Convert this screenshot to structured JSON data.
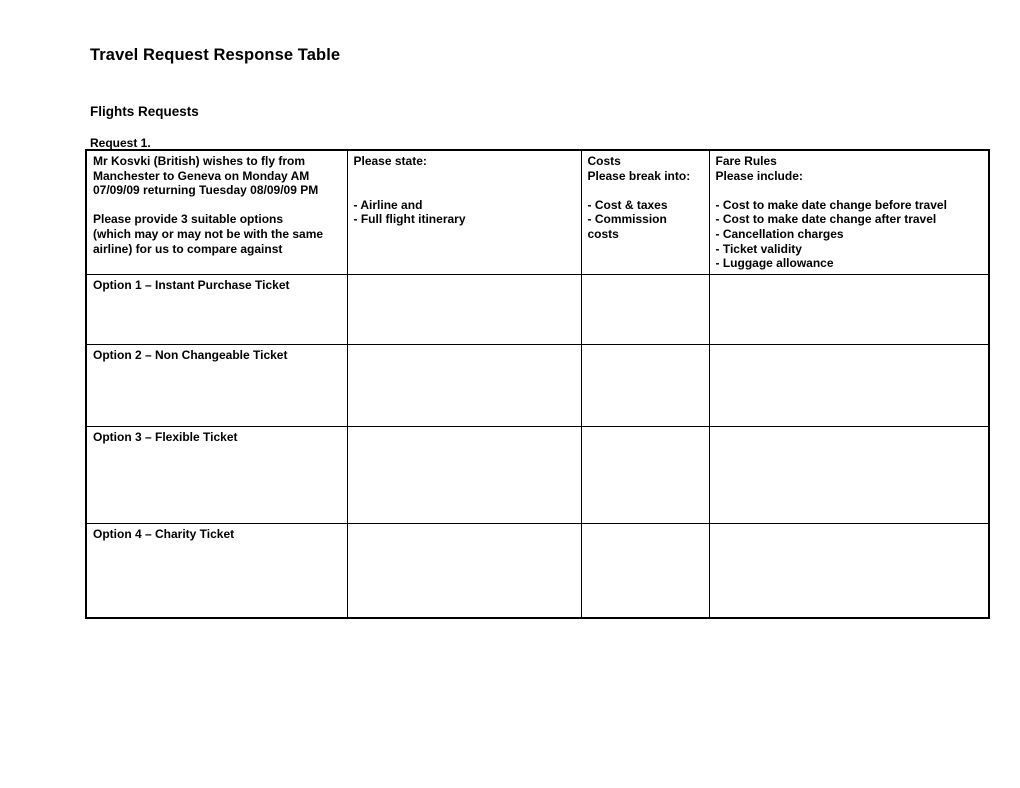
{
  "document": {
    "title": "Travel Request Response Table",
    "section_heading": "Flights Requests",
    "request_label": "Request 1."
  },
  "table": {
    "header_row": {
      "request_details": [
        "Mr Kosvki (British) wishes to fly from",
        "Manchester to Geneva on Monday AM",
        "07/09/09 returning Tuesday 08/09/09 PM",
        "",
        "Please provide 3 suitable options",
        "(which may or may not be with the same",
        "airline) for us to compare against"
      ],
      "please_state": [
        "Please state:",
        "",
        "",
        "- Airline and",
        "- Full flight itinerary"
      ],
      "costs": [
        "Costs",
        "Please break into:",
        "",
        "- Cost & taxes",
        "- Commission",
        "costs"
      ],
      "fare_rules": [
        "Fare Rules",
        "Please include:",
        "",
        "- Cost to make date change before travel",
        "- Cost to make date change after travel",
        "- Cancellation charges",
        "- Ticket validity",
        "- Luggage allowance"
      ]
    },
    "option_rows": [
      {
        "label": "Option 1 – Instant Purchase Ticket"
      },
      {
        "label": "Option 2 – Non Changeable Ticket"
      },
      {
        "label": "Option 3 – Flexible Ticket"
      },
      {
        "label": "Option 4 – Charity Ticket"
      }
    ]
  }
}
